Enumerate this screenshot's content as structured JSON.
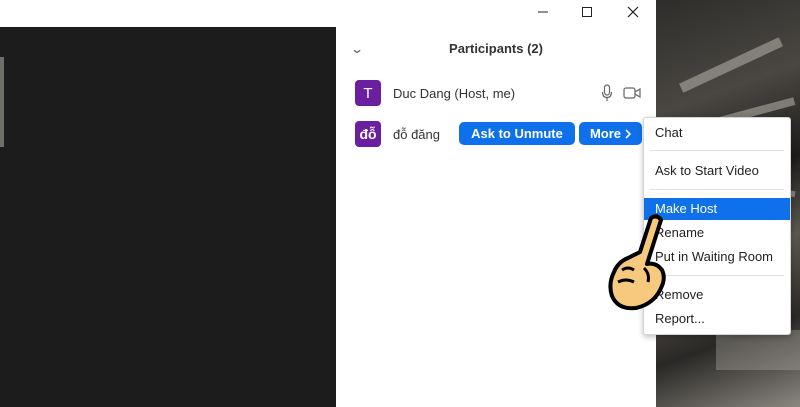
{
  "window": {
    "minimize_icon": "minimize-icon",
    "maximize_icon": "maximize-icon",
    "close_icon": "close-icon"
  },
  "panel": {
    "title": "Participants",
    "count": "(2)",
    "collapse_icon": "chevron-down-icon"
  },
  "participants": [
    {
      "initial": "T",
      "name": "Duc Dang (Host, me)",
      "avatar_color": "#6a1fa0",
      "icons": [
        "microphone-icon",
        "video-camera-icon"
      ]
    },
    {
      "initial": "đỗ",
      "name": "đỗ đăng",
      "avatar_color": "#6a1fa0",
      "actions": {
        "unmute": "Ask to Unmute",
        "more": "More",
        "more_icon": "chevron-right-icon"
      }
    }
  ],
  "context_menu": {
    "items": [
      "Chat",
      "Ask to Start Video",
      "Make Host",
      "Rename",
      "Put in Waiting Room",
      "Remove",
      "Report..."
    ],
    "highlighted": "Make Host"
  },
  "colors": {
    "accent": "#0e71eb",
    "avatar": "#6a1fa0",
    "video_bg": "#1c1c1c"
  },
  "overlay": {
    "pointer": "pointing-hand-icon"
  }
}
